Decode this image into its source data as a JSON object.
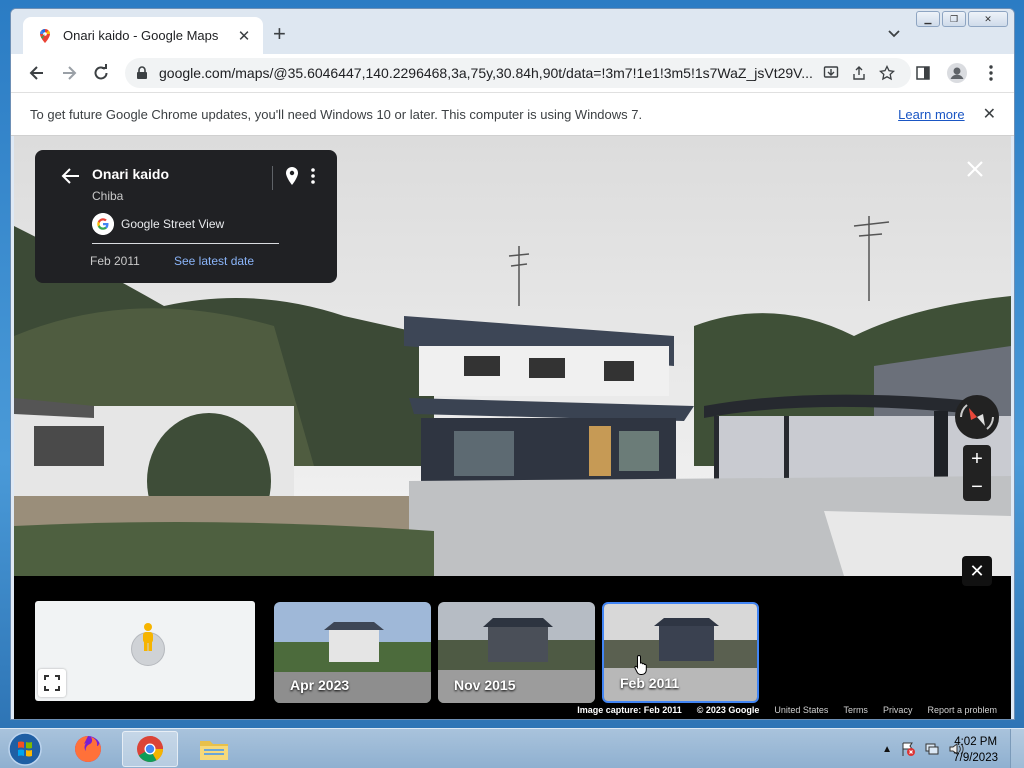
{
  "browser": {
    "tab_title": "Onari kaido - Google Maps",
    "url": "google.com/maps/@35.6046447,140.2296468,3a,75y,30.84h,90t/data=!3m7!1e1!3m5!1s7WaZ_jsVt29V..."
  },
  "infobar": {
    "message": "To get future Google Chrome updates, you'll need Windows 10 or later. This computer is using Windows 7.",
    "learn_more": "Learn more"
  },
  "card": {
    "place": "Onari kaido",
    "region": "Chiba",
    "source": "Google Street View",
    "date": "Feb 2011",
    "latest_link": "See latest date"
  },
  "strip": {
    "thumbs": [
      {
        "label": "Apr 2023",
        "selected": false
      },
      {
        "label": "Nov 2015",
        "selected": false
      },
      {
        "label": "Feb 2011",
        "selected": true
      }
    ]
  },
  "footer": {
    "capture": "Image capture: Feb 2011",
    "copyright": "© 2023 Google",
    "links": [
      "United States",
      "Terms",
      "Privacy",
      "Report a problem"
    ]
  },
  "taskbar": {
    "time": "4:02 PM",
    "date": "7/9/2023",
    "apps": [
      "start-orb-icon",
      "firefox-icon",
      "chrome-icon",
      "file-explorer-icon"
    ]
  },
  "colors": {
    "accent_blue": "#4285f4",
    "link_blue": "#8ab4f8",
    "card_bg": "#202124"
  }
}
